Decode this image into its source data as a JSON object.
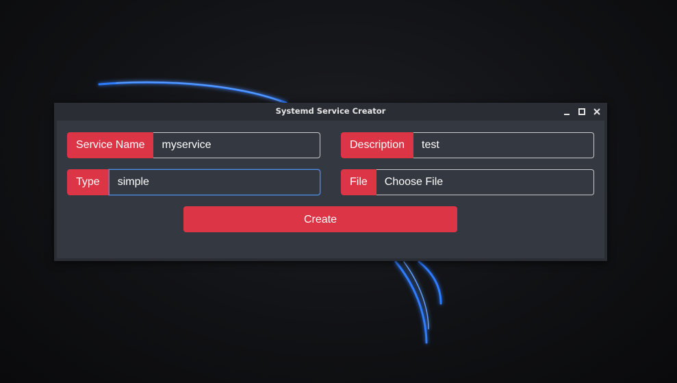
{
  "window": {
    "title": "Systemd Service Creator",
    "controls": [
      "minimize-icon",
      "maximize-icon",
      "close-icon"
    ]
  },
  "form": {
    "service_name": {
      "label": "Service Name",
      "value": "myservice"
    },
    "description": {
      "label": "Description",
      "value": "test"
    },
    "type": {
      "label": "Type",
      "value": "simple"
    },
    "file": {
      "label": "File",
      "button_text": "Choose File"
    },
    "create_label": "Create"
  },
  "colors": {
    "accent": "#dc3545",
    "panel": "#343840",
    "titlebar": "#2a2d33",
    "focus": "#4d8fe8",
    "wallpaper_arc": "#2f7bff"
  }
}
